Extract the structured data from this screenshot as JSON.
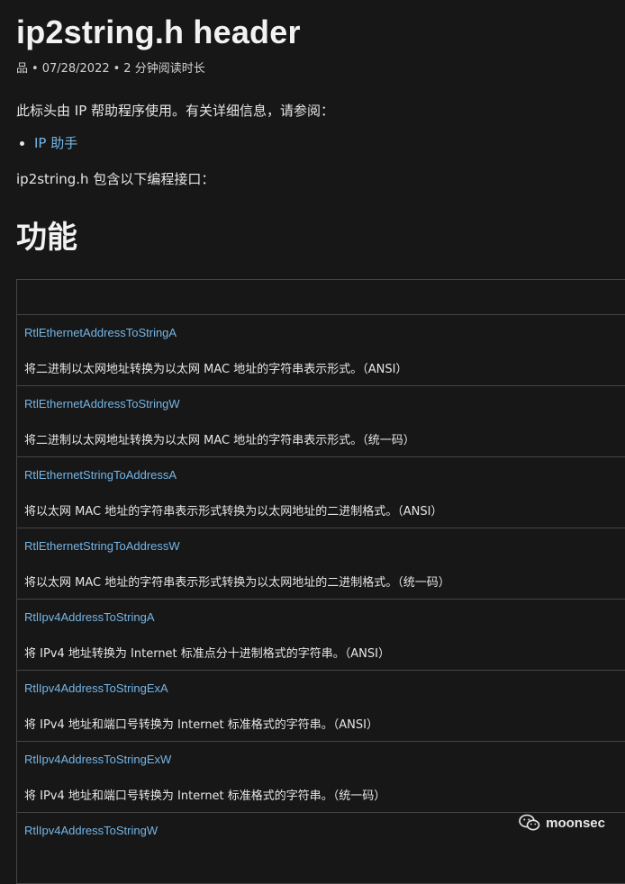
{
  "header": {
    "title": "ip2string.h header",
    "author": "品",
    "date": "07/28/2022",
    "read_time": "2 分钟阅读时长"
  },
  "intro": {
    "text": "此标头由 IP 帮助程序使用。有关详细信息，请参阅：",
    "links": [
      "IP 助手"
    ],
    "interfaces_text": "ip2string.h 包含以下编程接口："
  },
  "section": {
    "heading": "功能"
  },
  "functions": [
    {
      "name": "RtlEthernetAddressToStringA",
      "desc": "将二进制以太网地址转换为以太网 MAC 地址的字符串表示形式。（ANSI）"
    },
    {
      "name": "RtlEthernetAddressToStringW",
      "desc": "将二进制以太网地址转换为以太网 MAC 地址的字符串表示形式。（统一码）"
    },
    {
      "name": "RtlEthernetStringToAddressA",
      "desc": "将以太网 MAC 地址的字符串表示形式转换为以太网地址的二进制格式。（ANSI）"
    },
    {
      "name": "RtlEthernetStringToAddressW",
      "desc": "将以太网 MAC 地址的字符串表示形式转换为以太网地址的二进制格式。（统一码）"
    },
    {
      "name": "RtlIpv4AddressToStringA",
      "desc": "将 IPv4 地址转换为 Internet 标准点分十进制格式的字符串。（ANSI）"
    },
    {
      "name": "RtlIpv4AddressToStringExA",
      "desc": "将 IPv4 地址和端口号转换为 Internet 标准格式的字符串。（ANSI）"
    },
    {
      "name": "RtlIpv4AddressToStringExW",
      "desc": "将 IPv4 地址和端口号转换为 Internet 标准格式的字符串。（统一码）"
    },
    {
      "name": "RtlIpv4AddressToStringW",
      "desc": ""
    }
  ],
  "watermark": {
    "text": "moonsec",
    "icon": "wechat-icon"
  }
}
